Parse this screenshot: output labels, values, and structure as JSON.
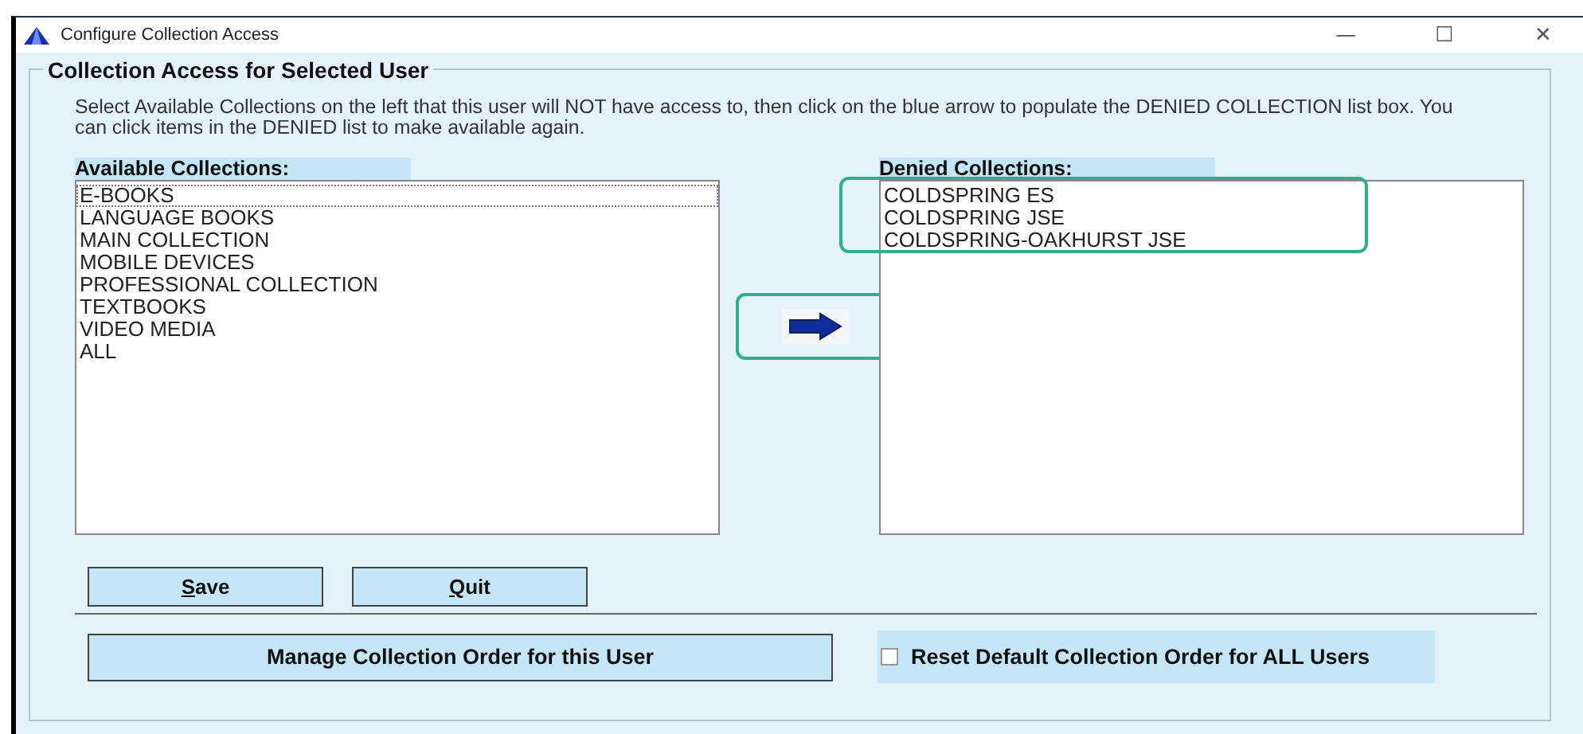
{
  "window": {
    "title": "Configure Collection Access",
    "controls": [
      "—",
      "☐",
      "✕"
    ]
  },
  "group": {
    "title": "Collection Access for Selected User",
    "description": "Select Available Collections on the left that this user will NOT have access to, then click on the blue arrow to populate the DENIED COLLECTION list box. You can click items in the DENIED list to make available again."
  },
  "available": {
    "label": "Available Collections:",
    "items": [
      {
        "text": "E-BOOKS",
        "focused": true
      },
      {
        "text": "LANGUAGE BOOKS",
        "focused": false
      },
      {
        "text": "MAIN COLLECTION",
        "focused": false
      },
      {
        "text": "MOBILE DEVICES",
        "focused": false
      },
      {
        "text": "PROFESSIONAL COLLECTION",
        "focused": false
      },
      {
        "text": "TEXTBOOKS",
        "focused": false
      },
      {
        "text": "VIDEO MEDIA",
        "focused": false
      },
      {
        "text": "ALL",
        "focused": false
      }
    ]
  },
  "denied": {
    "label": "Denied Collections:",
    "items": [
      "COLDSPRING ES",
      "COLDSPRING JSE",
      "COLDSPRING-OAKHURST JSE"
    ]
  },
  "buttons": [
    "Save",
    "Quit"
  ],
  "manage_button": "Manage Collection Order for this User",
  "reset_checkbox": {
    "label": "Reset Default Collection Order for ALL Users",
    "checked": false
  }
}
